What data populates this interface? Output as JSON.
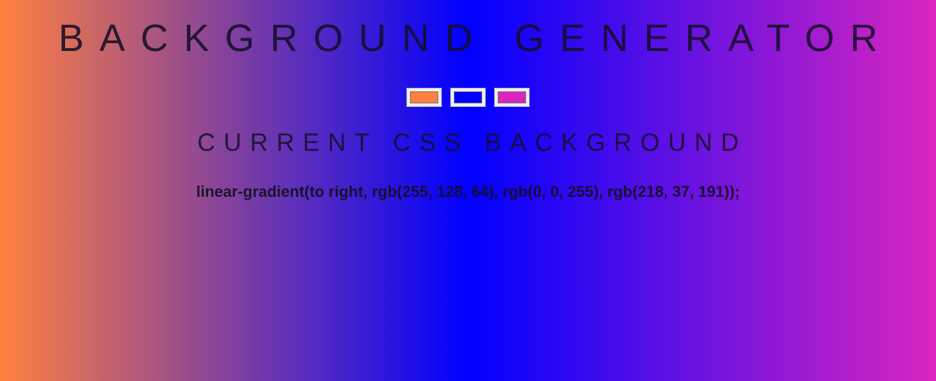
{
  "header": {
    "title": "BACKGROUND GENERATOR"
  },
  "color_pickers": [
    {
      "name": "color1",
      "value": "#ff8040"
    },
    {
      "name": "color2",
      "value": "#0000ff"
    },
    {
      "name": "color3",
      "value": "#da25bf"
    }
  ],
  "section": {
    "subtitle": "CURRENT CSS BACKGROUND"
  },
  "output": {
    "css_text": "linear-gradient(to right, rgb(255, 128, 64), rgb(0, 0, 255), rgb(218, 37, 191));"
  }
}
